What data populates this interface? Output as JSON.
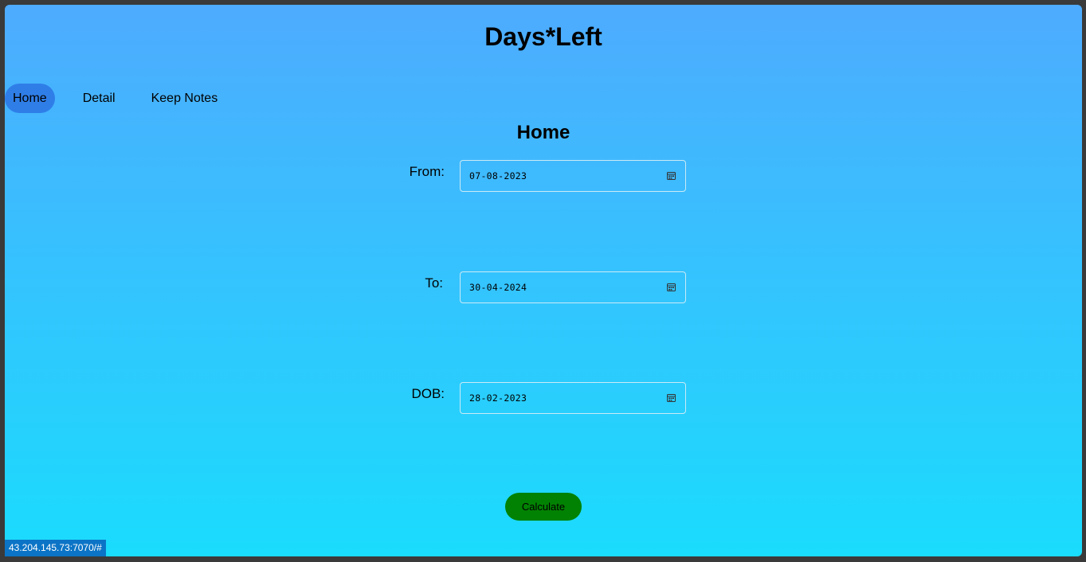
{
  "app": {
    "title": "Days*Left"
  },
  "nav": {
    "items": [
      {
        "label": "Home",
        "active": true
      },
      {
        "label": "Detail",
        "active": false
      },
      {
        "label": "Keep Notes",
        "active": false
      }
    ]
  },
  "main": {
    "section_title": "Home",
    "fields": [
      {
        "label": "From:",
        "value": "07-08-2023",
        "icon": "calendar-icon"
      },
      {
        "label": "To:",
        "value": "30-04-2024",
        "icon": "calendar-icon"
      },
      {
        "label": "DOB:",
        "value": "28-02-2023",
        "icon": "calendar-icon"
      }
    ],
    "calculate_label": "Calculate"
  },
  "status_bar": {
    "url": "43.204.145.73:7070/#"
  },
  "colors": {
    "gradient_top": "#4eabfe",
    "gradient_bottom": "#1adcfd",
    "nav_active": "#2f7ee8",
    "button_bg": "#028202",
    "status_bg": "#0b74c6"
  }
}
